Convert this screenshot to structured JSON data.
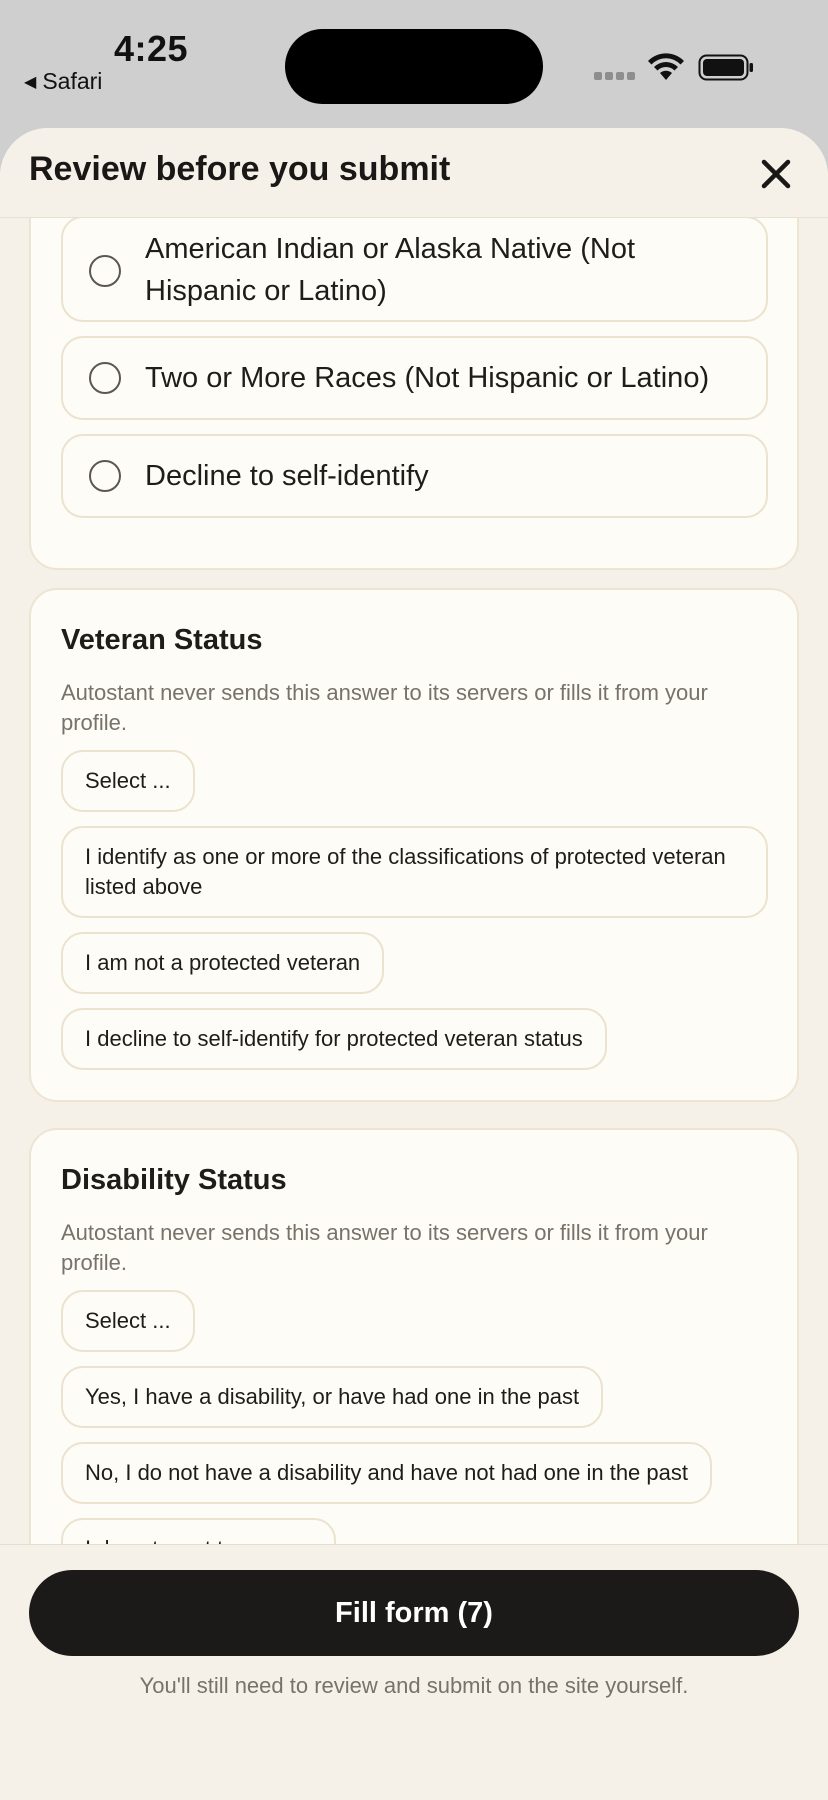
{
  "status_bar": {
    "time": "4:25",
    "back_app": "Safari"
  },
  "sheet": {
    "title": "Review before you submit"
  },
  "race_options": [
    "American Indian or Alaska Native (Not Hispanic or Latino)",
    "Two or More Races (Not Hispanic or Latino)",
    "Decline to self-identify"
  ],
  "veteran": {
    "title": "Veteran Status",
    "note": "Autostant never sends this answer to its servers or fills it from your profile.",
    "options": [
      "Select ...",
      "I identify as one or more of the classifications of protected veteran listed above",
      "I am not a protected veteran",
      "I decline to self-identify for protected veteran status"
    ]
  },
  "disability": {
    "title": "Disability Status",
    "note": "Autostant never sends this answer to its servers or fills it from your profile.",
    "options": [
      "Select ...",
      "Yes, I have a disability, or have had one in the past",
      "No, I do not have a disability and have not had one in the past",
      "I do not want to answer"
    ]
  },
  "footer": {
    "button_label": "Fill form (7)",
    "note": "You'll still need to review and submit on the site yourself."
  }
}
